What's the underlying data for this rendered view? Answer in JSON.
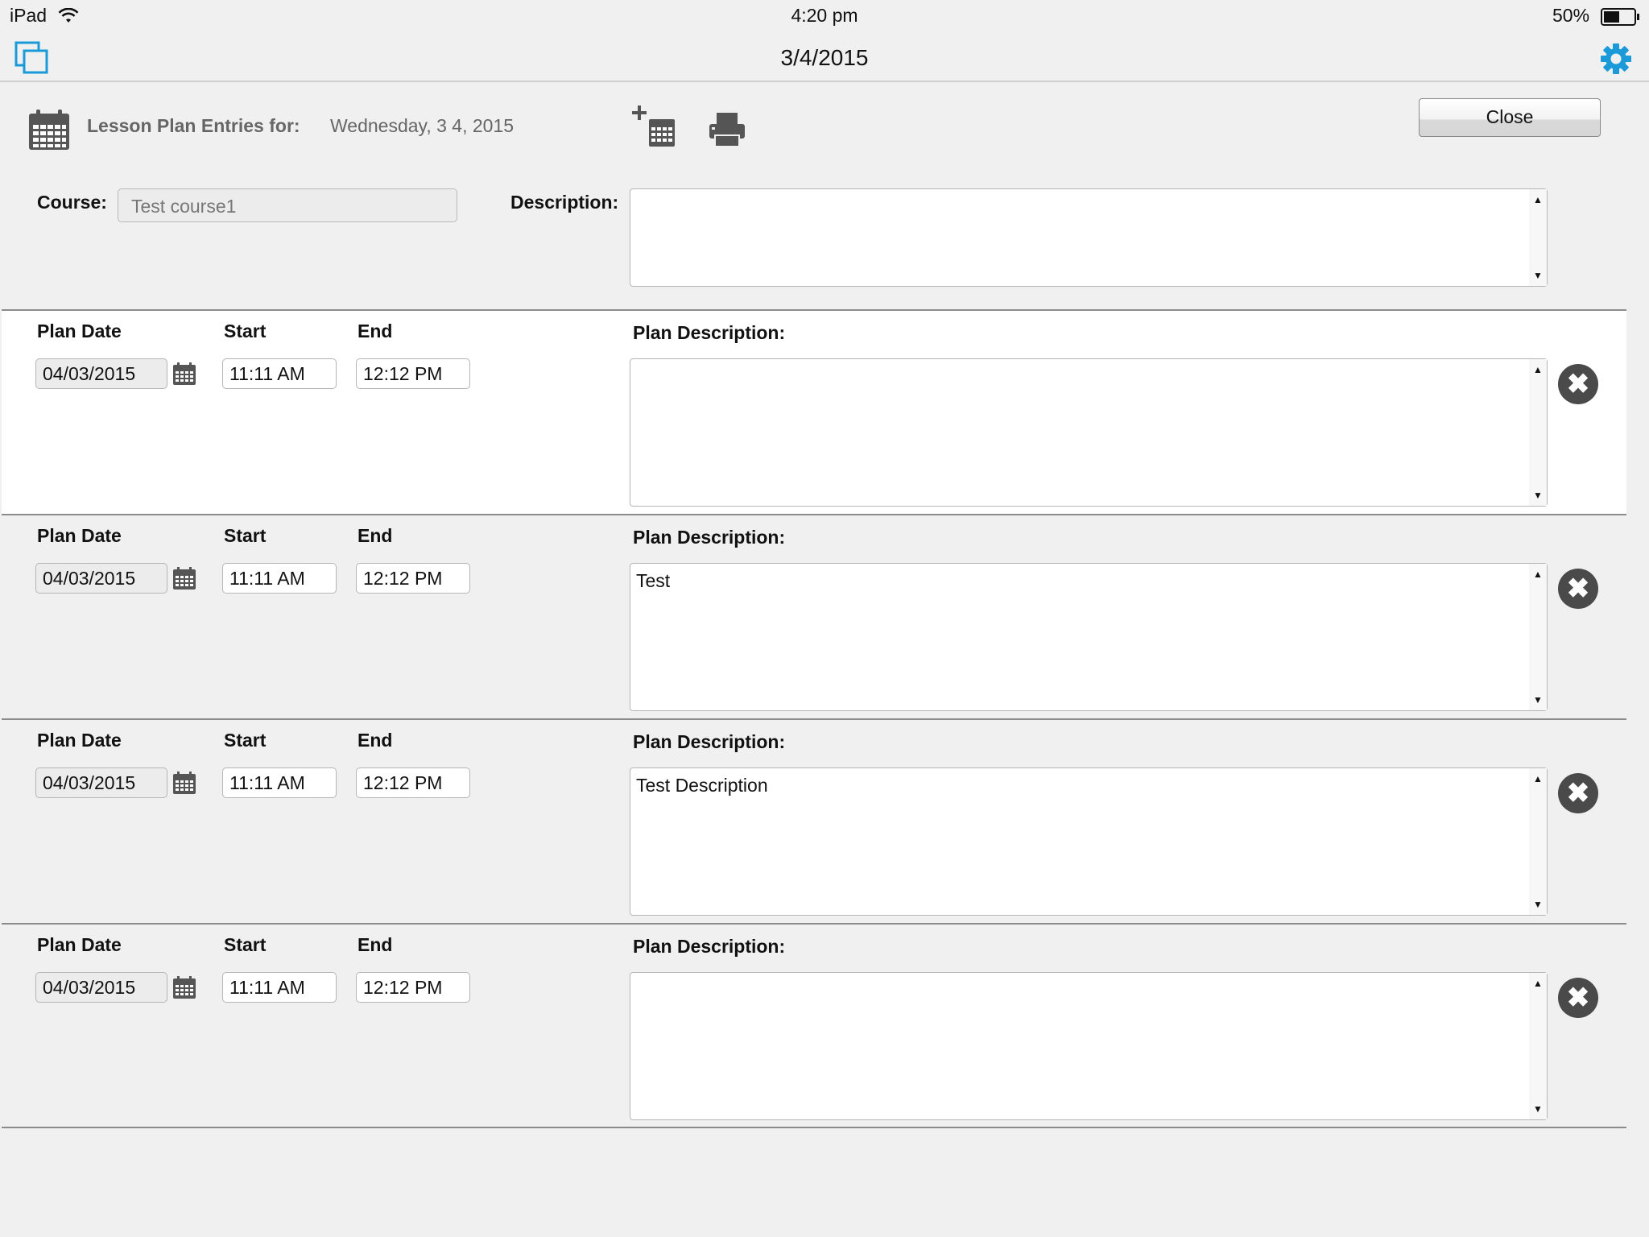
{
  "status_bar": {
    "device": "iPad",
    "time": "4:20 pm",
    "battery": "50%"
  },
  "nav": {
    "title": "3/4/2015",
    "left_icon": "windows-icon",
    "right_icon": "gear-icon"
  },
  "header": {
    "label": "Lesson Plan Entries for:",
    "date": "Wednesday, 3 4, 2015",
    "close_label": "Close",
    "icons": [
      "calendar-icon",
      "add-calendar-icon",
      "printer-icon"
    ]
  },
  "course": {
    "label": "Course:",
    "value": "Test course1"
  },
  "description": {
    "label": "Description:",
    "value": ""
  },
  "plan_labels": {
    "date": "Plan Date",
    "start": "Start",
    "end": "End",
    "description": "Plan Description:"
  },
  "plans": [
    {
      "date": "04/03/2015",
      "start": "11:11 AM",
      "end": "12:12 PM",
      "description": ""
    },
    {
      "date": "04/03/2015",
      "start": "11:11 AM",
      "end": "12:12 PM",
      "description": "Test"
    },
    {
      "date": "04/03/2015",
      "start": "11:11 AM",
      "end": "12:12 PM",
      "description": "Test Description"
    },
    {
      "date": "04/03/2015",
      "start": "11:11 AM",
      "end": "12:12 PM",
      "description": ""
    }
  ],
  "colors": {
    "accent": "#1a9ad9",
    "icon_gray": "#555555",
    "row_selected": "#ffffff",
    "background": "#f0f0f0"
  }
}
